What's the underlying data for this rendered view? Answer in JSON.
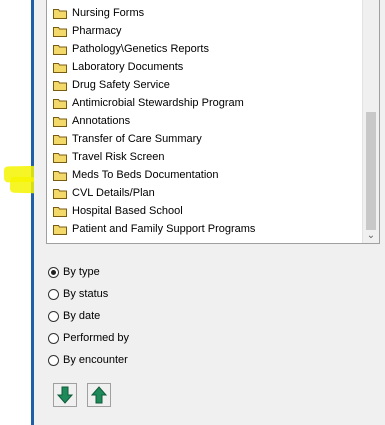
{
  "document_folders": {
    "items": [
      {
        "label": "Nursing Forms"
      },
      {
        "label": "Pharmacy"
      },
      {
        "label": "Pathology\\Genetics Reports"
      },
      {
        "label": "Laboratory Documents"
      },
      {
        "label": "Drug Safety Service"
      },
      {
        "label": "Antimicrobial Stewardship Program"
      },
      {
        "label": "Annotations"
      },
      {
        "label": "Transfer of Care Summary"
      },
      {
        "label": "Travel Risk Screen"
      },
      {
        "label": "Meds To Beds Documentation"
      },
      {
        "label": "CVL Details/Plan"
      },
      {
        "label": "Hospital Based School"
      },
      {
        "label": "Patient and Family Support Programs"
      }
    ],
    "scroll_down_glyph": "⌄"
  },
  "sort_options": {
    "selected": "By type",
    "options": [
      {
        "label": "By type",
        "selected": true
      },
      {
        "label": "By status",
        "selected": false
      },
      {
        "label": "By date",
        "selected": false
      },
      {
        "label": "Performed by",
        "selected": false
      },
      {
        "label": "By encounter",
        "selected": false
      }
    ]
  },
  "buttons": {
    "move_down_icon": "arrow-down-icon",
    "move_up_icon": "arrow-up-icon"
  },
  "colors": {
    "arrow_green": "#1e8a5a",
    "folder_yellow": "#f3d86a",
    "highlight": "#f5f500"
  }
}
